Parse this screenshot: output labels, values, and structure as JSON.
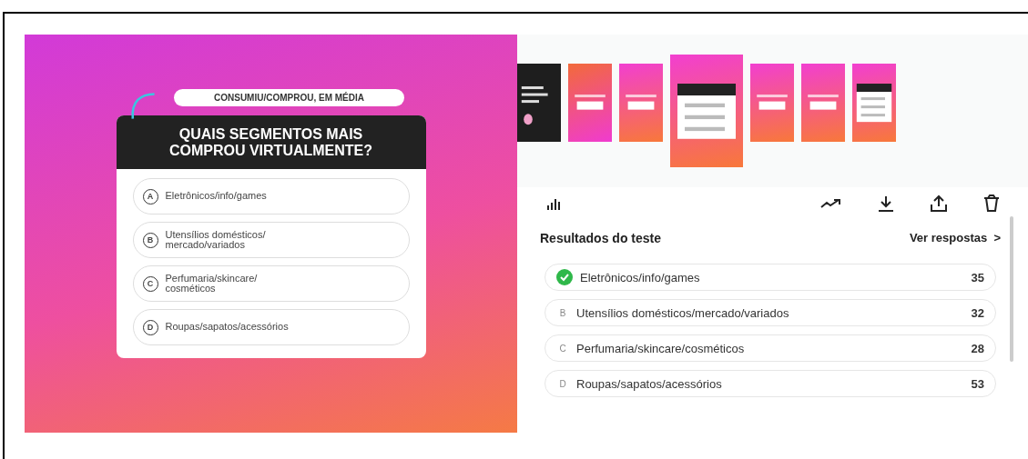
{
  "story": {
    "tag": "CONSUMIU/COMPROU, EM MÉDIA",
    "question": "QUAIS SEGMENTOS MAIS COMPROU VIRTUALMENTE?",
    "options": [
      {
        "letter": "A",
        "label": "Eletrônicos/info/games"
      },
      {
        "letter": "B",
        "label": "Utensílios domésticos/ mercado/variados"
      },
      {
        "letter": "C",
        "label": "Perfumaria/skincare/ cosméticos"
      },
      {
        "letter": "D",
        "label": "Roupas/sapatos/acessórios"
      }
    ]
  },
  "thumbnails": [
    {
      "kind": "dark",
      "selected": false
    },
    {
      "kind": "pink",
      "selected": false
    },
    {
      "kind": "orange",
      "selected": false
    },
    {
      "kind": "quiz",
      "selected": true
    },
    {
      "kind": "orange",
      "selected": false
    },
    {
      "kind": "orange",
      "selected": false
    },
    {
      "kind": "quiz",
      "selected": false
    }
  ],
  "results": {
    "title": "Resultados do teste",
    "link": "Ver respostas  >",
    "answers": [
      {
        "correct": true,
        "label": "Eletrônicos/info/games",
        "count": "35"
      },
      {
        "correct": false,
        "letter": "B",
        "label": "Utensílios domésticos/mercado/variados",
        "count": "32"
      },
      {
        "correct": false,
        "letter": "C",
        "label": "Perfumaria/skincare/cosméticos",
        "count": "28"
      },
      {
        "correct": false,
        "letter": "D",
        "label": "Roupas/sapatos/acessórios",
        "count": "53"
      }
    ]
  }
}
